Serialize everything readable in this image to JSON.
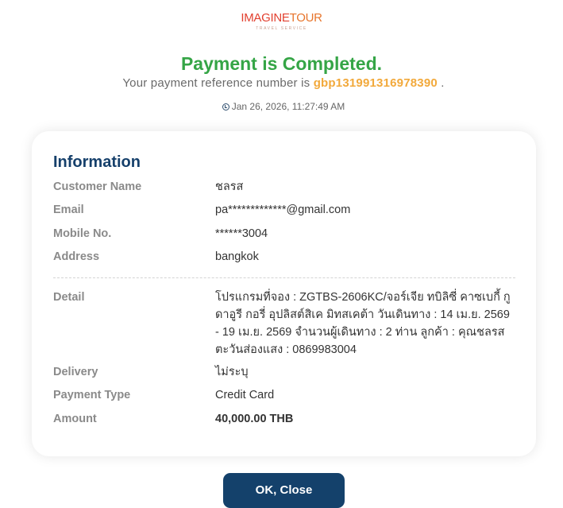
{
  "logo": {
    "part1": "IMAGINE",
    "part2": "TOUR",
    "tagline": "TRAVEL SERVICE"
  },
  "title": "Payment is Completed.",
  "reference": {
    "prefix": "Your payment reference number is",
    "number": "gbp131991316978390",
    "suffix": "."
  },
  "timestamp": "Jan 26, 2026, 11:27:49 AM",
  "info": {
    "heading": "Information",
    "rows": [
      {
        "label": "Customer Name",
        "value": "ชลรส"
      },
      {
        "label": "Email",
        "value": "pa*************@gmail.com"
      },
      {
        "label": "Mobile No.",
        "value": "******3004"
      },
      {
        "label": "Address",
        "value": "bangkok"
      },
      {
        "label": "Detail",
        "value": "โปรแกรมที่จอง : ZGTBS-2606KC/จอร์เจีย ทบิลิซี่ คาซเบกี้ กูดาอูรี กอรี่ อุปลิสต์สิเค มิทสเคต้า วันเดินทาง : 14 เม.ย. 2569 - 19 เม.ย. 2569 จำนวนผู้เดินทาง : 2 ท่าน ลูกค้า : คุณชลรส ตะวันส่องแสง : 0869983004"
      },
      {
        "label": "Delivery",
        "value": "ไม่ระบุ"
      },
      {
        "label": "Payment Type",
        "value": "Credit Card"
      },
      {
        "label": "Amount",
        "value": "40,000.00 THB"
      }
    ]
  },
  "button": {
    "label": "OK, Close"
  },
  "colors": {
    "success": "#35a546",
    "reference": "#f2a93b",
    "heading": "#16406b",
    "button": "#14416b"
  },
  "icons": {
    "timestamp": "clock-icon"
  }
}
